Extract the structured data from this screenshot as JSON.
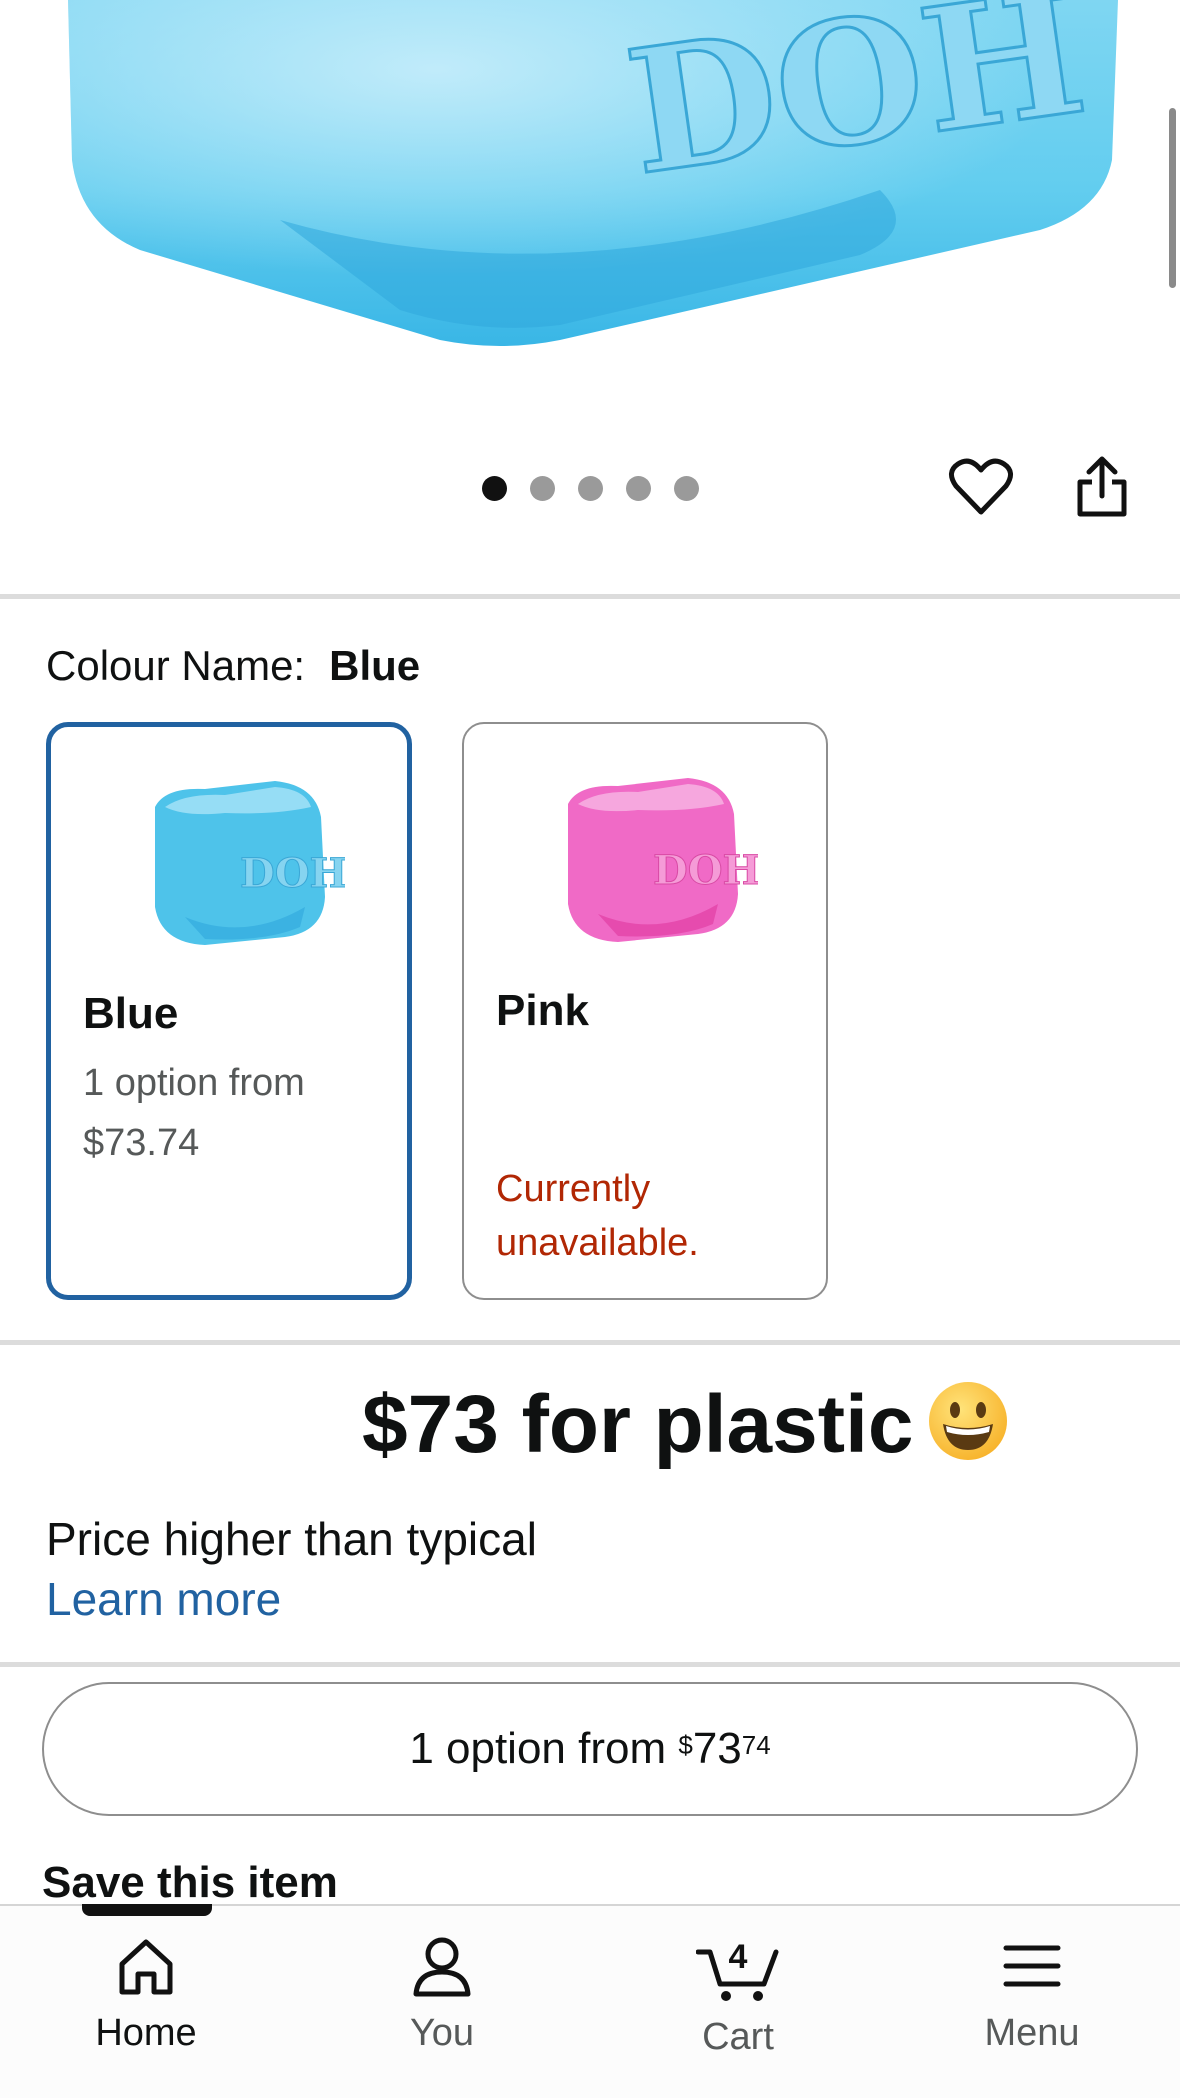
{
  "product": {
    "image_dots": 5,
    "active_dot": 0
  },
  "colour": {
    "label": "Colour Name:",
    "value": "Blue",
    "options": [
      {
        "name": "Blue",
        "line1": "1 option from",
        "line2": "$73.74",
        "selected": true,
        "color": "#4ec3ea"
      },
      {
        "name": "Pink",
        "unavailable_line1": "Currently",
        "unavailable_line2": "unavailable.",
        "selected": false,
        "color": "#f06ac6"
      }
    ]
  },
  "headline": "$73 for plastic",
  "price_note": "Price higher than typical",
  "learn_more": "Learn more",
  "options_button": {
    "text": "1 option from ",
    "currency": "$",
    "dollars": "73",
    "cents": "74"
  },
  "save_item": "Save this item",
  "bottom_nav": {
    "items": [
      {
        "label": "Home",
        "icon": "home-icon",
        "active": true
      },
      {
        "label": "You",
        "icon": "person-icon",
        "active": false
      },
      {
        "label": "Cart",
        "icon": "cart-icon",
        "badge": "4",
        "active": false
      },
      {
        "label": "Menu",
        "icon": "menu-icon",
        "active": false
      }
    ]
  },
  "colors": {
    "accent_blue": "#2162a1",
    "unavailable_red": "#b12704"
  }
}
